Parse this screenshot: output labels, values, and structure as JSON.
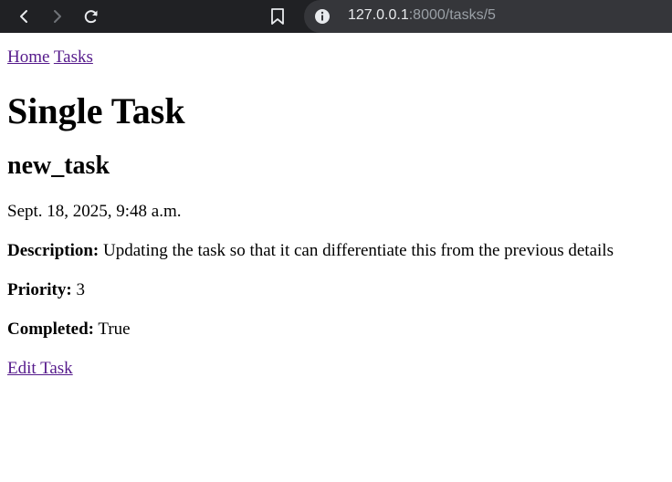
{
  "browser": {
    "url_host": "127.0.0.1",
    "url_path": ":8000/tasks/5"
  },
  "nav": {
    "home": "Home",
    "tasks": "Tasks"
  },
  "page_title": "Single Task",
  "task": {
    "name": "new_task",
    "date": "Sept. 18, 2025, 9:48 a.m.",
    "description_label": "Description:",
    "description": "Updating the task so that it can differentiate this from the previous details",
    "priority_label": "Priority:",
    "priority": "3",
    "completed_label": "Completed:",
    "completed": "True"
  },
  "edit_link": "Edit Task"
}
